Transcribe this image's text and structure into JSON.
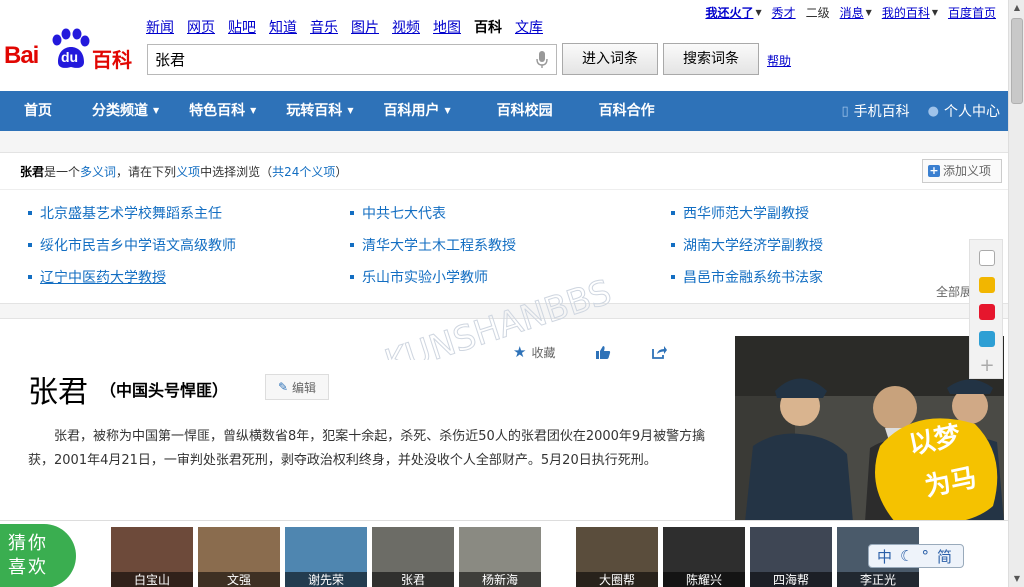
{
  "topnav": [
    "新闻",
    "网页",
    "贴吧",
    "知道",
    "音乐",
    "图片",
    "视频",
    "地图",
    "百科",
    "文库"
  ],
  "topnav_current": "百科",
  "logo": {
    "bai": "Bai",
    "du": "du",
    "baike": "百科"
  },
  "search": {
    "value": "张君",
    "enter_label": "进入词条",
    "search_label": "搜索词条",
    "help": "帮助"
  },
  "userbar": {
    "user": "我还火了",
    "xiucai": "秀才",
    "level": "二级",
    "messages": "消息",
    "my_baike": "我的百科",
    "home": "百度首页"
  },
  "mainnav": {
    "items": [
      {
        "label": "首页",
        "dropdown": false
      },
      {
        "label": "分类频道",
        "dropdown": true
      },
      {
        "label": "特色百科",
        "dropdown": true
      },
      {
        "label": "玩转百科",
        "dropdown": true
      },
      {
        "label": "百科用户",
        "dropdown": true
      },
      {
        "label": "百科校园",
        "dropdown": false
      },
      {
        "label": "百科合作",
        "dropdown": false
      }
    ],
    "mobile": "手机百科",
    "personal": "个人中心"
  },
  "disambiguation": {
    "term": "张君",
    "text_a": "是一个",
    "polysemy": "多义词",
    "text_b": "，请在下列",
    "sense_word": "义项",
    "text_c": "中选择浏览（",
    "count": "共24个义项",
    "text_d": "）",
    "add_label": "添加义项",
    "all_label": "全部展开",
    "senses": [
      "北京盛基艺术学校舞蹈系主任",
      "中共七大代表",
      "西华师范大学副教授",
      "绥化市民吉乡中学语文高级教师",
      "清华大学土木工程系教授",
      "湖南大学经济学副教授",
      "辽宁中医药大学教授",
      "乐山市实验小学教师",
      "昌邑市金融系统书法家"
    ]
  },
  "article": {
    "title": "张君",
    "subtitle": "（中国头号悍匪）",
    "edit": "编辑",
    "collect": "收藏",
    "summary": "张君，被称为中国第一悍匪，曾纵横数省8年，犯案十余起，杀死、杀伤近50人的张君团伙在2000年9月被警方擒获，2001年4月21日，一审判处张君死刑，剥夺政治权利终身，并处没收个人全部财产。5月20日执行死刑。",
    "photo_stamp": "以梦为马"
  },
  "guess": {
    "label_line1": "猜你",
    "label_line2": "喜欢",
    "items": [
      "白宝山",
      "文强",
      "谢先荣",
      "张君",
      "杨新海",
      "大圈帮",
      "陈耀兴",
      "四海帮",
      "李正光"
    ]
  },
  "ime": {
    "mode": "中",
    "punct": "°",
    "variant": "简"
  },
  "watermark": "KUNSHANBBS"
}
